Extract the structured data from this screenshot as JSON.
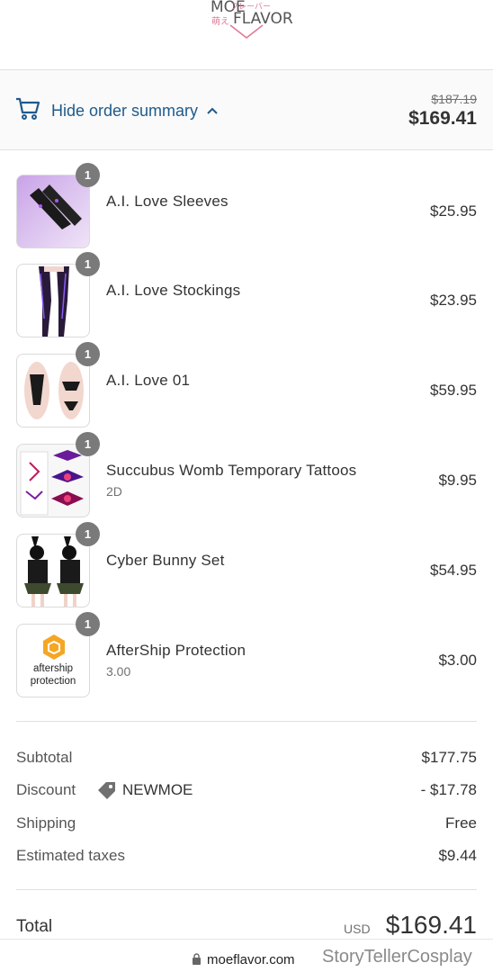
{
  "logo": {
    "text_top": "MOE",
    "text_bottom": "FLAVOR",
    "kana": "フレーバー",
    "kanji": "萌え"
  },
  "summary_toggle": {
    "icon": "cart-icon",
    "label": "Hide order summary",
    "chevron": "chevron-up-icon",
    "original_total": "$187.19",
    "total": "$169.41",
    "accent_color": "#1f5a8c"
  },
  "items": [
    {
      "qty": "1",
      "name": "A.I. Love Sleeves",
      "variant": "",
      "price": "$25.95",
      "image": "black sleeves on purple background"
    },
    {
      "qty": "1",
      "name": "A.I. Love Stockings",
      "variant": "",
      "price": "$23.95",
      "image": "purple and black stockings"
    },
    {
      "qty": "1",
      "name": "A.I. Love 01",
      "variant": "",
      "price": "$59.95",
      "image": "black lingerie set"
    },
    {
      "qty": "1",
      "name": "Succubus Womb Temporary Tattoos",
      "variant": "2D",
      "price": "$9.95",
      "image": "temporary tattoo sheets"
    },
    {
      "qty": "1",
      "name": "Cyber Bunny Set",
      "variant": "",
      "price": "$54.95",
      "image": "black bunny outfit"
    },
    {
      "qty": "1",
      "name": "AfterShip Protection",
      "variant": "3.00",
      "price": "$3.00",
      "image": "aftership protection logo"
    }
  ],
  "aftership_logo": {
    "line1": "aftership",
    "line2": "protection",
    "color": "#f5a623"
  },
  "costs": {
    "subtotal_label": "Subtotal",
    "subtotal_value": "$177.75",
    "discount_label": "Discount",
    "discount_code": "NEWMOE",
    "discount_value": "- $17.78",
    "shipping_label": "Shipping",
    "shipping_value": "Free",
    "taxes_label": "Estimated taxes",
    "taxes_value": "$9.44"
  },
  "total": {
    "label": "Total",
    "currency": "USD",
    "amount": "$169.41"
  },
  "browser": {
    "domain": "moeflavor.com",
    "watermark": "StoryTellerCosplay"
  }
}
